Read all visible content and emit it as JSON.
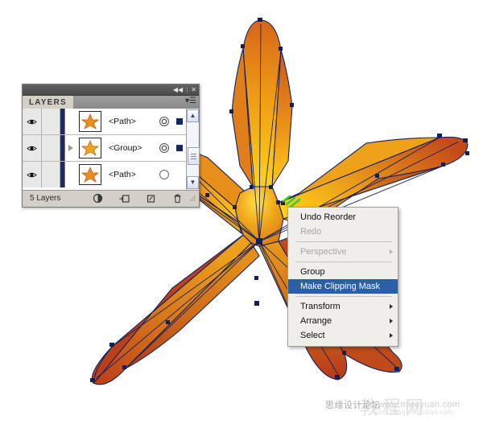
{
  "app": {
    "title": "Adobe Illustrator artwork canvas",
    "document_object": "starfish"
  },
  "layers_panel": {
    "tab_label": "LAYERS",
    "titlebar": {
      "collapse_icon": "collapse-double-left-icon",
      "collapse_glyph": "◀◀",
      "separator": "|",
      "close_icon": "close-icon",
      "close_glyph": "✕"
    },
    "panel_menu_icon": "panel-menu-icon",
    "panel_menu_glyph": "▾☰",
    "columns": [
      "visibility",
      "lock",
      "color",
      "disclosure",
      "thumbnail",
      "name",
      "target",
      "selection"
    ],
    "rows": [
      {
        "name": "<Path>",
        "visible": true,
        "locked": false,
        "color": "#1a2a6e",
        "has_disclosure": false,
        "target_style": "double-ring",
        "selected": true,
        "thumbnail": "starfish-thumbnail"
      },
      {
        "name": "<Group>",
        "visible": true,
        "locked": false,
        "color": "#1a2a6e",
        "has_disclosure": true,
        "target_style": "double-ring",
        "selected": true,
        "thumbnail": "starfish-thumbnail"
      },
      {
        "name": "<Path>",
        "visible": true,
        "locked": false,
        "color": "#1a2a6e",
        "has_disclosure": false,
        "target_style": "single-ring",
        "selected": false,
        "thumbnail": "starfish-thumbnail"
      }
    ],
    "scrollbar": {
      "up_glyph": "▲",
      "down_glyph": "▼"
    },
    "footer": {
      "count_label": "5 Layers",
      "buttons": [
        {
          "icon": "make-clipping-mask-icon",
          "label": "Make/Release Clipping Mask"
        },
        {
          "icon": "new-sublayer-icon",
          "label": "Create New Sublayer"
        },
        {
          "icon": "new-layer-icon",
          "label": "Create New Layer"
        },
        {
          "icon": "delete-selection-icon",
          "label": "Delete Selection"
        }
      ],
      "resize_grip_icon": "resize-grip-icon"
    }
  },
  "context_menu": {
    "items": [
      {
        "label": "Undo Reorder",
        "disabled": false,
        "submenu": false,
        "selected": false
      },
      {
        "label": "Redo",
        "disabled": true,
        "submenu": false,
        "selected": false
      },
      {
        "separator_after": true
      },
      {
        "label": "Perspective",
        "disabled": true,
        "submenu": true,
        "selected": false
      },
      {
        "separator_after": true
      },
      {
        "label": "Group",
        "disabled": false,
        "submenu": false,
        "selected": false
      },
      {
        "label": "Make Clipping Mask",
        "disabled": false,
        "submenu": false,
        "selected": true
      },
      {
        "separator_after": true
      },
      {
        "label": "Transform",
        "disabled": false,
        "submenu": true,
        "selected": false
      },
      {
        "label": "Arrange",
        "disabled": false,
        "submenu": true,
        "selected": false
      },
      {
        "label": "Select",
        "disabled": false,
        "submenu": true,
        "selected": false
      }
    ],
    "highlight_color": "#2b5fa8",
    "submenu_arrow_glyph": "▶"
  },
  "artwork": {
    "shape": "five-armed starfish with vector paths and anchor points",
    "gradient_light": "#ffd21a",
    "gradient_mid": "#e8901a",
    "gradient_dark": "#c03a1a",
    "stroke_color": "#16205a",
    "anchor_color": "#151f55",
    "cursor_color": "#33cc33"
  },
  "watermark": {
    "forum_text": "思缘设计论坛",
    "big_text": "教程网",
    "url_text": "www.missyuan.com",
    "sub_text": "jiaocheng.chazidian.com"
  }
}
